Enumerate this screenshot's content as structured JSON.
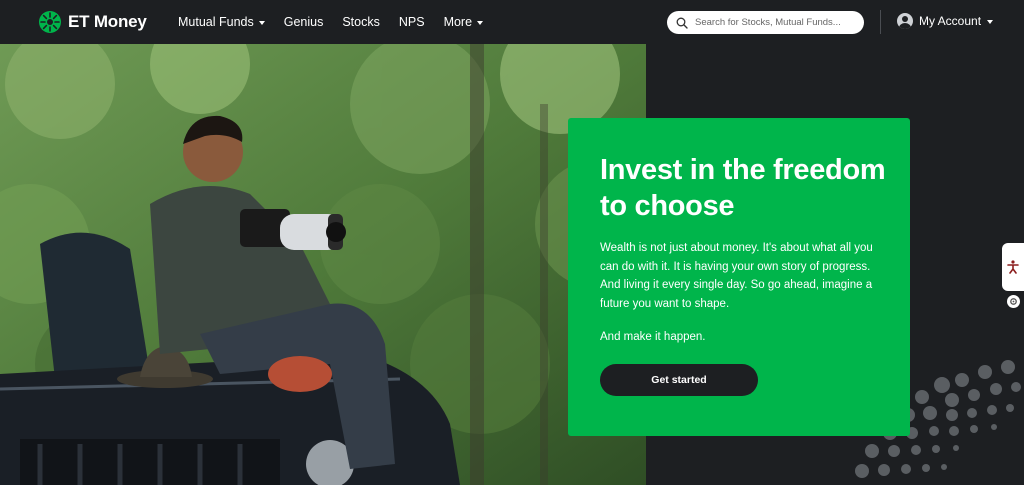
{
  "brand": {
    "name": "ET Money",
    "accent": "#00b54b",
    "dark": "#1d1f22"
  },
  "nav": {
    "items": [
      {
        "label": "Mutual Funds",
        "has_caret": true
      },
      {
        "label": "Genius",
        "has_caret": false
      },
      {
        "label": "Stocks",
        "has_caret": false
      },
      {
        "label": "NPS",
        "has_caret": false
      },
      {
        "label": "More",
        "has_caret": true
      }
    ],
    "search": {
      "placeholder": "Search for Stocks, Mutual Funds..."
    },
    "account_label": "My Account"
  },
  "hero": {
    "title": "Invest in the freedom to choose",
    "body": "Wealth is not just about money. It's about what all you can do with it. It is having your own story of progress. And living it every single day. So go ahead, imagine a future you want to shape.",
    "cta_text": "And make it happen.",
    "button_label": "Get started"
  },
  "icons": [
    "et-money-logo-icon",
    "caret-down-icon",
    "search-icon",
    "avatar-icon",
    "accessibility-icon",
    "gear-icon"
  ]
}
